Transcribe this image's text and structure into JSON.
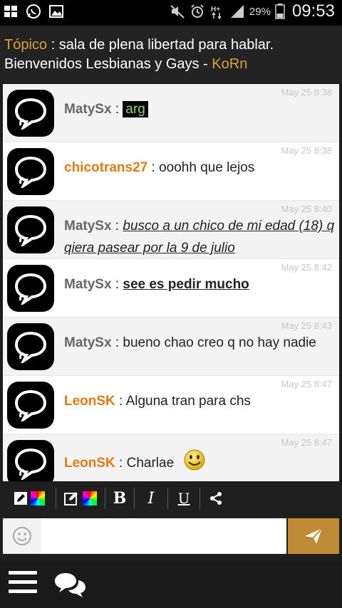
{
  "status_bar": {
    "left_icons": [
      "window-icon",
      "whatsapp-icon",
      "gallery-icon"
    ],
    "right_icons": [
      "mute-icon",
      "alarm-icon",
      "hplus-data-icon",
      "signal-icon",
      "battery-icon"
    ],
    "battery_percent": "29%",
    "time": "09:53"
  },
  "topic": {
    "label": "Tópico",
    "separator": " : ",
    "text": "sala de plena libertad para hablar. Bienvenidos Lesbianas y Gays - ",
    "author": "KoRn"
  },
  "messages": [
    {
      "nick": "MatySx",
      "sep": " : ",
      "text": "arg",
      "time": "May 25 8:38"
    },
    {
      "nick": "chicotrans27",
      "sep": " : ",
      "text": "ooohh que lejos",
      "time": "May 25 8:38"
    },
    {
      "nick": "MatySx",
      "sep": " : ",
      "text": "busco a un chico de mi edad (18) q qiera pasear por la 9 de julio",
      "time": "May 25 8:40"
    },
    {
      "nick": "MatySx",
      "sep": " : ",
      "text": "see es pedir mucho",
      "time": "May 25 8:42"
    },
    {
      "nick": "MatySx",
      "sep": " : ",
      "text": "bueno chao creo q no hay nadie",
      "time": "May 25 8:43"
    },
    {
      "nick": "LeonSK",
      "sep": " : ",
      "text": "Alguna tran para chs",
      "time": "May 25 8:47"
    },
    {
      "nick": "LeonSK",
      "sep": " : ",
      "text": "Charlae",
      "time": "May 25 8:47"
    }
  ],
  "toolbar": {
    "bold": "B",
    "italic": "I",
    "underline": "U"
  },
  "input": {
    "value": "",
    "placeholder": ""
  },
  "colors": {
    "accent": "#c18b35",
    "topic_gold": "#d8a23a",
    "nick_orange": "#e27a12",
    "nick_gray": "#666666"
  }
}
